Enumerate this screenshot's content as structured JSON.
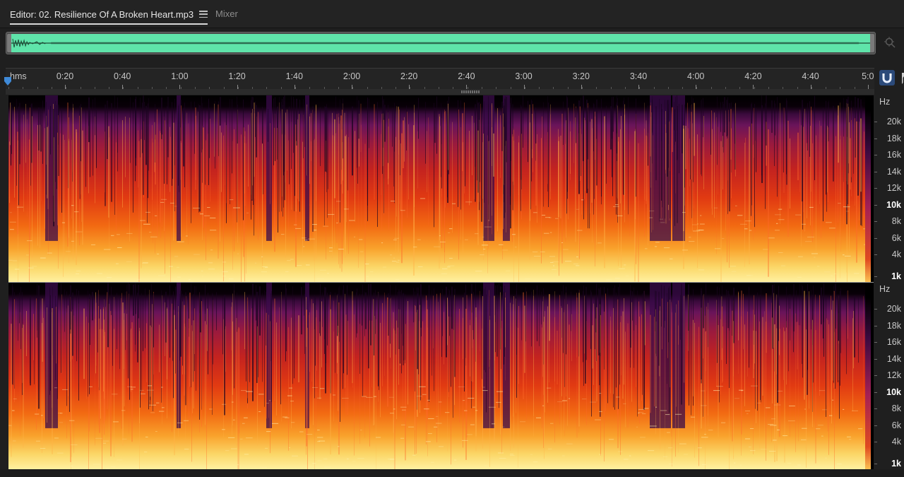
{
  "tabs": {
    "editor_label": "Editor: 02. Resilience Of A Broken Heart.mp3",
    "mixer_label": "Mixer"
  },
  "colors": {
    "overview_waveform": "#5fe4aa",
    "snap_button": "#2b4a7a",
    "playhead": "#3f8ad8"
  },
  "icons": {
    "tab_menu": "hamburger-menu-icon",
    "zoom": "zoom-to-selection-icon",
    "snap": "magnet-snap-icon",
    "playhead": "playhead-marker-icon"
  },
  "ruler": {
    "unit_label": "hms",
    "ticks": [
      "0:20",
      "0:40",
      "1:00",
      "1:20",
      "1:40",
      "2:00",
      "2:20",
      "2:40",
      "3:00",
      "3:20",
      "3:40",
      "4:00",
      "4:20",
      "4:40",
      "5:0"
    ]
  },
  "frequency_axis": {
    "unit": "Hz",
    "labels": [
      {
        "text": "20k",
        "hz": 20000,
        "strong": false
      },
      {
        "text": "18k",
        "hz": 18000,
        "strong": false
      },
      {
        "text": "16k",
        "hz": 16000,
        "strong": false
      },
      {
        "text": "14k",
        "hz": 14000,
        "strong": false
      },
      {
        "text": "12k",
        "hz": 12000,
        "strong": false
      },
      {
        "text": "10k",
        "hz": 10000,
        "strong": true
      },
      {
        "text": "8k",
        "hz": 8000,
        "strong": false
      },
      {
        "text": "6k",
        "hz": 6000,
        "strong": false
      },
      {
        "text": "4k",
        "hz": 4000,
        "strong": false
      },
      {
        "text": "1k",
        "hz": 1000,
        "strong": true
      }
    ]
  }
}
